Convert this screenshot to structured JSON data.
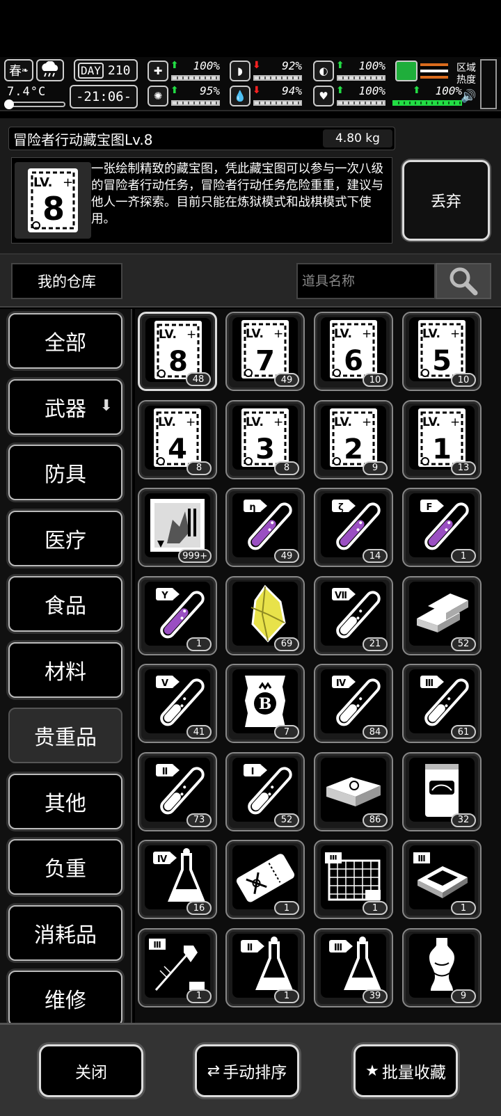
{
  "hud": {
    "season": "春",
    "temperature": "7.4°C",
    "day_label": "DAY",
    "day_number": "210",
    "clock": "-21:06-",
    "stats": [
      {
        "icon": "medkit-icon",
        "glyph": "✚",
        "trend": "up",
        "arrow": "⬆",
        "value": "100%"
      },
      {
        "icon": "stomach-icon",
        "glyph": "◗",
        "trend": "down",
        "arrow": "⬇",
        "value": "92%"
      },
      {
        "icon": "pill-icon",
        "glyph": "◐",
        "trend": "up",
        "arrow": "⬆",
        "value": "100%"
      },
      {
        "icon": "brain-icon",
        "glyph": "✺",
        "trend": "up",
        "arrow": "⬆",
        "value": "95%"
      },
      {
        "icon": "water-drop-icon",
        "glyph": "💧",
        "trend": "down",
        "arrow": "⬇",
        "value": "94%"
      },
      {
        "icon": "heart-icon",
        "glyph": "♥",
        "trend": "up",
        "arrow": "⬆",
        "value": "100%"
      }
    ],
    "special_stat": {
      "icon": "flask-green-icon",
      "trend": "up",
      "arrow": "⬆",
      "value": "100%"
    },
    "region_label": "区域\n热度",
    "colors": {
      "up": "#22dd44",
      "down": "#ff2222"
    }
  },
  "item": {
    "title": "冒险者行动藏宝图Lv.8",
    "weight": "4.80 kg",
    "level": "8",
    "description": "一张绘制精致的藏宝图，凭此藏宝图可以参与一次八级的冒险者行动任务，冒险者行动任务危险重重，建议与他人一齐探索。目前只能在炼狱模式和战棋模式下使用。",
    "discard_label": "丢弃"
  },
  "search": {
    "warehouse_tab": "我的仓库",
    "placeholder": "道具名称"
  },
  "categories": [
    {
      "label": "全部",
      "active": false
    },
    {
      "label": "武器",
      "active": false,
      "has_arrow": true
    },
    {
      "label": "防具",
      "active": false
    },
    {
      "label": "医疗",
      "active": false
    },
    {
      "label": "食品",
      "active": false
    },
    {
      "label": "材料",
      "active": false
    },
    {
      "label": "贵重品",
      "active": true
    },
    {
      "label": "其他",
      "active": false
    },
    {
      "label": "负重",
      "active": false
    },
    {
      "label": "消耗品",
      "active": false
    },
    {
      "label": "维修",
      "active": false
    }
  ],
  "items": [
    {
      "icon": "treasure-map-icon",
      "mark": "8",
      "count": "48",
      "selected": true
    },
    {
      "icon": "treasure-map-icon",
      "mark": "7",
      "count": "49"
    },
    {
      "icon": "treasure-map-icon",
      "mark": "6",
      "count": "10"
    },
    {
      "icon": "treasure-map-icon",
      "mark": "5",
      "count": "10"
    },
    {
      "icon": "treasure-map-icon",
      "mark": "4",
      "count": "8"
    },
    {
      "icon": "treasure-map-icon",
      "mark": "3",
      "count": "8"
    },
    {
      "icon": "treasure-map-icon",
      "mark": "2",
      "count": "9"
    },
    {
      "icon": "treasure-map-icon",
      "mark": "1",
      "count": "13"
    },
    {
      "icon": "monster-card-icon",
      "mark": "",
      "count": "999+"
    },
    {
      "icon": "purple-test-tube-icon",
      "mark": "η",
      "count": "49"
    },
    {
      "icon": "purple-test-tube-icon",
      "mark": "ζ",
      "count": "14"
    },
    {
      "icon": "purple-test-tube-icon",
      "mark": "F",
      "count": "1"
    },
    {
      "icon": "purple-test-tube-icon",
      "mark": "Y",
      "count": "1"
    },
    {
      "icon": "yellow-crystal-icon",
      "mark": "",
      "count": "69"
    },
    {
      "icon": "test-tube-icon",
      "mark": "Ⅶ",
      "count": "21"
    },
    {
      "icon": "gold-bars-icon",
      "mark": "",
      "count": "52"
    },
    {
      "icon": "test-tube-icon",
      "mark": "Ⅴ",
      "count": "41"
    },
    {
      "icon": "b-badge-paper-icon",
      "mark": "",
      "count": "7"
    },
    {
      "icon": "test-tube-icon",
      "mark": "Ⅳ",
      "count": "84"
    },
    {
      "icon": "test-tube-icon",
      "mark": "Ⅲ",
      "count": "61"
    },
    {
      "icon": "test-tube-icon",
      "mark": "Ⅱ",
      "count": "73"
    },
    {
      "icon": "test-tube-icon",
      "mark": "Ⅰ",
      "count": "52"
    },
    {
      "icon": "cash-stack-icon",
      "mark": "",
      "count": "86"
    },
    {
      "icon": "can-icon",
      "mark": "",
      "count": "32"
    },
    {
      "icon": "flask-icon",
      "mark": "Ⅳ",
      "count": "16"
    },
    {
      "icon": "ticket-icon",
      "mark": "",
      "count": "1"
    },
    {
      "icon": "blueprint-grid-icon",
      "mark": "Ⅲ",
      "count": "1"
    },
    {
      "icon": "chip-icon",
      "mark": "Ⅲ",
      "count": "1"
    },
    {
      "icon": "syringe-gem-icon",
      "mark": "Ⅲ",
      "count": "1"
    },
    {
      "icon": "flask-icon",
      "mark": "Ⅱ",
      "count": "1"
    },
    {
      "icon": "flask-icon",
      "mark": "Ⅲ",
      "count": "39"
    },
    {
      "icon": "vase-icon",
      "mark": "",
      "count": "9"
    }
  ],
  "bottom": {
    "close_label": "关闭",
    "sort_label": "手动排序",
    "favorite_label": "批量收藏"
  }
}
